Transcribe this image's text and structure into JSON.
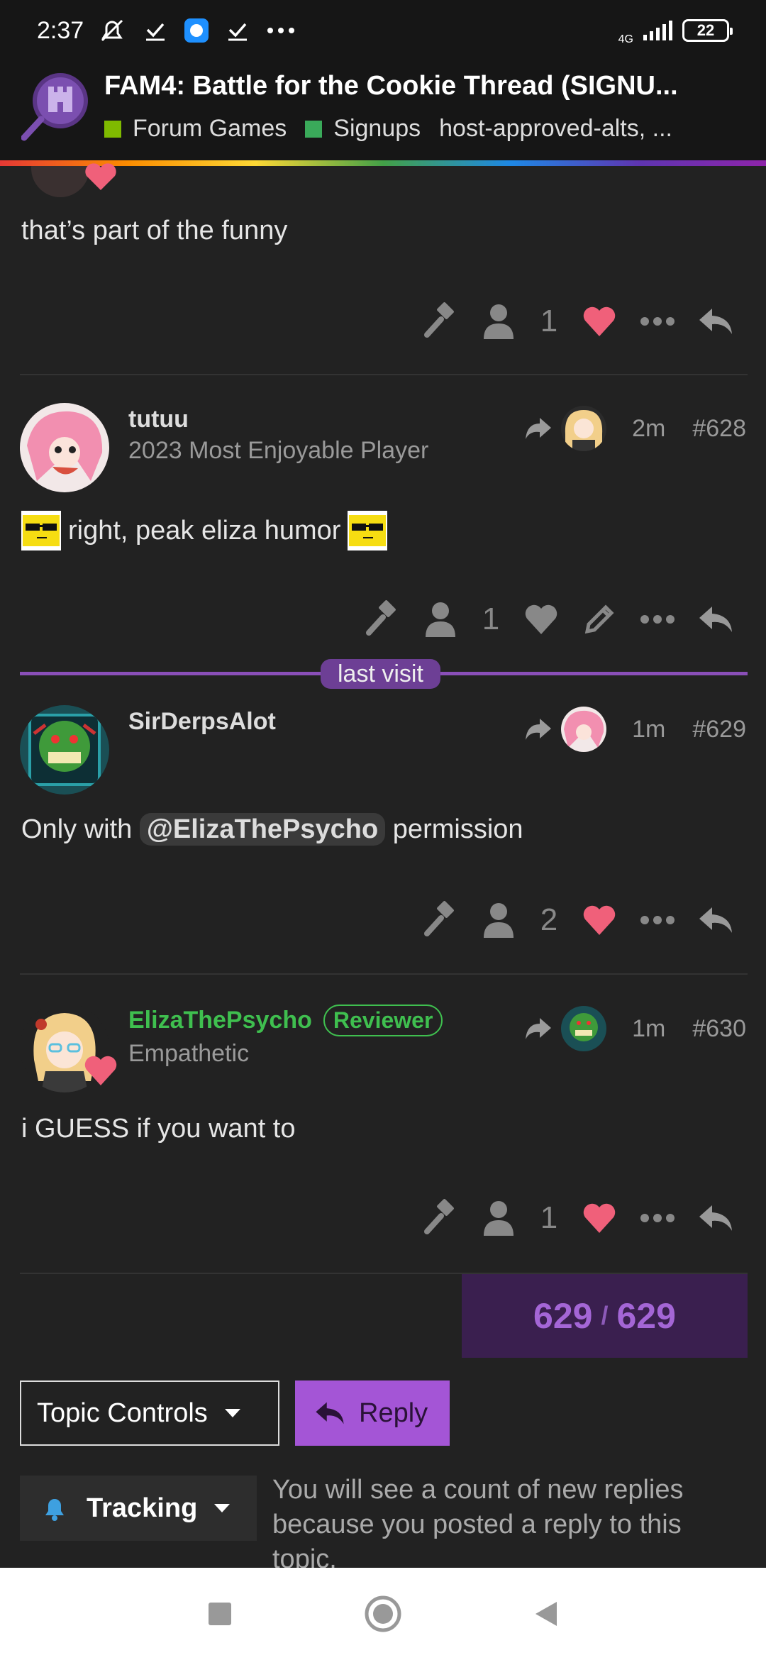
{
  "status_bar": {
    "time": "2:37",
    "network": "4G",
    "battery": "22"
  },
  "header": {
    "title": "FAM4: Battle for the Cookie Thread (SIGNU...",
    "categories": [
      {
        "label": "Forum Games",
        "color": "#7fba00"
      },
      {
        "label": "Signups",
        "color": "#3aaa5a"
      }
    ],
    "tags": "host-approved-alts, ..."
  },
  "posts": [
    {
      "text": "that’s part of the funny",
      "likes": "1"
    },
    {
      "username": "tutuu",
      "user_title": "2023 Most Enjoyable Player",
      "time": "2m",
      "number": "#628",
      "text": "right, peak eliza humor",
      "likes": "1"
    },
    {
      "username": "SirDerpsAlot",
      "time": "1m",
      "number": "#629",
      "text_before": "Only with",
      "mention": "@ElizaThePsycho",
      "text_after": "permission",
      "likes": "2"
    },
    {
      "username": "ElizaThePsycho",
      "badge": "Reviewer",
      "user_title": "Empathetic",
      "time": "1m",
      "number": "#630",
      "text": "i GUESS if you want to",
      "likes": "1"
    }
  ],
  "last_visit_label": "last visit",
  "progress": {
    "current": "629",
    "separator": "/",
    "total": "629"
  },
  "controls": {
    "topic_controls": "Topic Controls",
    "reply": "Reply",
    "tracking": "Tracking",
    "tracking_desc": "You will see a count of new replies because you posted a reply to this topic."
  },
  "colors": {
    "accent": "#a455d6",
    "like": "#f0607a",
    "staff_green": "#3fbf4f"
  }
}
